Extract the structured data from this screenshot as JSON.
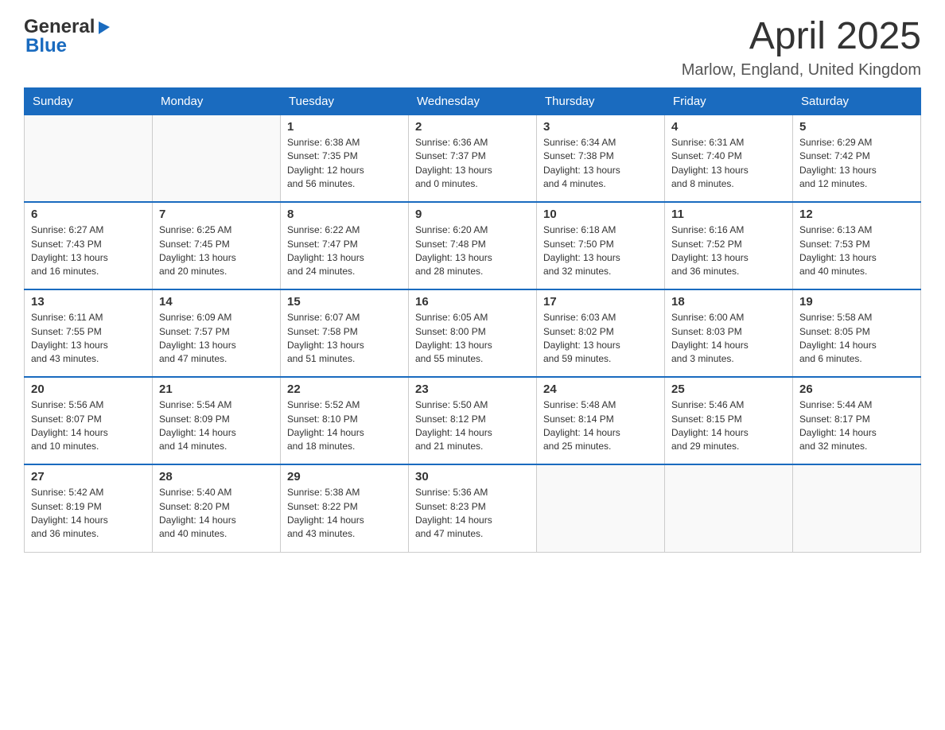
{
  "logo": {
    "general": "General",
    "blue": "Blue",
    "arrow": "▶"
  },
  "title": "April 2025",
  "location": "Marlow, England, United Kingdom",
  "days_of_week": [
    "Sunday",
    "Monday",
    "Tuesday",
    "Wednesday",
    "Thursday",
    "Friday",
    "Saturday"
  ],
  "weeks": [
    [
      {
        "day": "",
        "info": ""
      },
      {
        "day": "",
        "info": ""
      },
      {
        "day": "1",
        "info": "Sunrise: 6:38 AM\nSunset: 7:35 PM\nDaylight: 12 hours\nand 56 minutes."
      },
      {
        "day": "2",
        "info": "Sunrise: 6:36 AM\nSunset: 7:37 PM\nDaylight: 13 hours\nand 0 minutes."
      },
      {
        "day": "3",
        "info": "Sunrise: 6:34 AM\nSunset: 7:38 PM\nDaylight: 13 hours\nand 4 minutes."
      },
      {
        "day": "4",
        "info": "Sunrise: 6:31 AM\nSunset: 7:40 PM\nDaylight: 13 hours\nand 8 minutes."
      },
      {
        "day": "5",
        "info": "Sunrise: 6:29 AM\nSunset: 7:42 PM\nDaylight: 13 hours\nand 12 minutes."
      }
    ],
    [
      {
        "day": "6",
        "info": "Sunrise: 6:27 AM\nSunset: 7:43 PM\nDaylight: 13 hours\nand 16 minutes."
      },
      {
        "day": "7",
        "info": "Sunrise: 6:25 AM\nSunset: 7:45 PM\nDaylight: 13 hours\nand 20 minutes."
      },
      {
        "day": "8",
        "info": "Sunrise: 6:22 AM\nSunset: 7:47 PM\nDaylight: 13 hours\nand 24 minutes."
      },
      {
        "day": "9",
        "info": "Sunrise: 6:20 AM\nSunset: 7:48 PM\nDaylight: 13 hours\nand 28 minutes."
      },
      {
        "day": "10",
        "info": "Sunrise: 6:18 AM\nSunset: 7:50 PM\nDaylight: 13 hours\nand 32 minutes."
      },
      {
        "day": "11",
        "info": "Sunrise: 6:16 AM\nSunset: 7:52 PM\nDaylight: 13 hours\nand 36 minutes."
      },
      {
        "day": "12",
        "info": "Sunrise: 6:13 AM\nSunset: 7:53 PM\nDaylight: 13 hours\nand 40 minutes."
      }
    ],
    [
      {
        "day": "13",
        "info": "Sunrise: 6:11 AM\nSunset: 7:55 PM\nDaylight: 13 hours\nand 43 minutes."
      },
      {
        "day": "14",
        "info": "Sunrise: 6:09 AM\nSunset: 7:57 PM\nDaylight: 13 hours\nand 47 minutes."
      },
      {
        "day": "15",
        "info": "Sunrise: 6:07 AM\nSunset: 7:58 PM\nDaylight: 13 hours\nand 51 minutes."
      },
      {
        "day": "16",
        "info": "Sunrise: 6:05 AM\nSunset: 8:00 PM\nDaylight: 13 hours\nand 55 minutes."
      },
      {
        "day": "17",
        "info": "Sunrise: 6:03 AM\nSunset: 8:02 PM\nDaylight: 13 hours\nand 59 minutes."
      },
      {
        "day": "18",
        "info": "Sunrise: 6:00 AM\nSunset: 8:03 PM\nDaylight: 14 hours\nand 3 minutes."
      },
      {
        "day": "19",
        "info": "Sunrise: 5:58 AM\nSunset: 8:05 PM\nDaylight: 14 hours\nand 6 minutes."
      }
    ],
    [
      {
        "day": "20",
        "info": "Sunrise: 5:56 AM\nSunset: 8:07 PM\nDaylight: 14 hours\nand 10 minutes."
      },
      {
        "day": "21",
        "info": "Sunrise: 5:54 AM\nSunset: 8:09 PM\nDaylight: 14 hours\nand 14 minutes."
      },
      {
        "day": "22",
        "info": "Sunrise: 5:52 AM\nSunset: 8:10 PM\nDaylight: 14 hours\nand 18 minutes."
      },
      {
        "day": "23",
        "info": "Sunrise: 5:50 AM\nSunset: 8:12 PM\nDaylight: 14 hours\nand 21 minutes."
      },
      {
        "day": "24",
        "info": "Sunrise: 5:48 AM\nSunset: 8:14 PM\nDaylight: 14 hours\nand 25 minutes."
      },
      {
        "day": "25",
        "info": "Sunrise: 5:46 AM\nSunset: 8:15 PM\nDaylight: 14 hours\nand 29 minutes."
      },
      {
        "day": "26",
        "info": "Sunrise: 5:44 AM\nSunset: 8:17 PM\nDaylight: 14 hours\nand 32 minutes."
      }
    ],
    [
      {
        "day": "27",
        "info": "Sunrise: 5:42 AM\nSunset: 8:19 PM\nDaylight: 14 hours\nand 36 minutes."
      },
      {
        "day": "28",
        "info": "Sunrise: 5:40 AM\nSunset: 8:20 PM\nDaylight: 14 hours\nand 40 minutes."
      },
      {
        "day": "29",
        "info": "Sunrise: 5:38 AM\nSunset: 8:22 PM\nDaylight: 14 hours\nand 43 minutes."
      },
      {
        "day": "30",
        "info": "Sunrise: 5:36 AM\nSunset: 8:23 PM\nDaylight: 14 hours\nand 47 minutes."
      },
      {
        "day": "",
        "info": ""
      },
      {
        "day": "",
        "info": ""
      },
      {
        "day": "",
        "info": ""
      }
    ]
  ]
}
